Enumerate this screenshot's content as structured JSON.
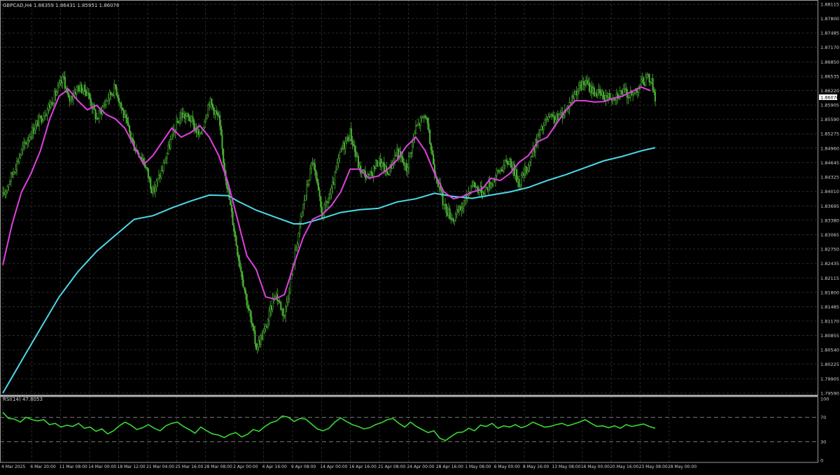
{
  "header": {
    "symbol": "GBPCAD,H4",
    "ohlc": "1.86359 1.86431 1.85951 1.86076"
  },
  "rsi_header": "RSI(14) 47.8053",
  "colors": {
    "background": "#000000",
    "grid": "#3a3a3a",
    "candles": "#4caf37",
    "ma_fast": "#e040e0",
    "ma_slow": "#4dd9e8",
    "rsi": "#39d833",
    "axis_text": "#cfcfcf",
    "price_tag_bg": "#ffffff"
  },
  "chart_data": [
    {
      "type": "candlestick",
      "title": "GBPCAD,H4",
      "price_axis_ticks": [
        "1.88115",
        "1.87800",
        "1.87485",
        "1.87170",
        "1.86850",
        "1.86535",
        "1.86220",
        "1.85905",
        "1.85590",
        "1.85275",
        "1.84960",
        "1.84645",
        "1.84325",
        "1.84010",
        "1.83695",
        "1.83380",
        "1.83065",
        "1.82750",
        "1.82435",
        "1.82115",
        "1.81800",
        "1.81485",
        "1.81170",
        "1.80855",
        "1.80540",
        "1.80225",
        "1.79905",
        "1.79590"
      ],
      "current_price_label": "1.86076",
      "ylim": [
        1.7959,
        1.88115
      ],
      "grid": true,
      "time_axis_labels": [
        "4 Mar 2025",
        "6 Mar 20:00",
        "11 Mar 08:00",
        "14 Mar 00:00",
        "18 Mar 12:00",
        "21 Mar 04:00",
        "25 Mar 16:00",
        "28 Mar 08:00",
        "2 Apr 00:00",
        "4 Apr 16:00",
        "9 Apr 08:00",
        "14 Apr 00:00",
        "16 Apr 16:00",
        "21 Apr 08:00",
        "24 Apr 00:00",
        "28 Apr 16:00",
        "1 May 08:00",
        "6 May 00:00",
        "8 May 16:00",
        "13 May 08:00",
        "16 May 00:00",
        "20 May 16:00",
        "23 May 08:00",
        "28 May 00:00"
      ],
      "price_path": [
        [
          0,
          1.839
        ],
        [
          2,
          1.844
        ],
        [
          4,
          1.849
        ],
        [
          6,
          1.853
        ],
        [
          8,
          1.856
        ],
        [
          10,
          1.859
        ],
        [
          12,
          1.863
        ],
        [
          13,
          1.865
        ],
        [
          14,
          1.86
        ],
        [
          16,
          1.863
        ],
        [
          18,
          1.862
        ],
        [
          20,
          1.856
        ],
        [
          22,
          1.86
        ],
        [
          24,
          1.863
        ],
        [
          26,
          1.856
        ],
        [
          28,
          1.85
        ],
        [
          30,
          1.847
        ],
        [
          32,
          1.84
        ],
        [
          34,
          1.845
        ],
        [
          36,
          1.852
        ],
        [
          38,
          1.857
        ],
        [
          40,
          1.856
        ],
        [
          42,
          1.852
        ],
        [
          44,
          1.86
        ],
        [
          46,
          1.856
        ],
        [
          47,
          1.847
        ],
        [
          48,
          1.84
        ],
        [
          50,
          1.827
        ],
        [
          52,
          1.816
        ],
        [
          54,
          1.806
        ],
        [
          56,
          1.81
        ],
        [
          58,
          1.818
        ],
        [
          60,
          1.813
        ],
        [
          62,
          1.825
        ],
        [
          64,
          1.837
        ],
        [
          66,
          1.847
        ],
        [
          68,
          1.835
        ],
        [
          70,
          1.84
        ],
        [
          72,
          1.849
        ],
        [
          74,
          1.853
        ],
        [
          76,
          1.845
        ],
        [
          78,
          1.843
        ],
        [
          80,
          1.847
        ],
        [
          82,
          1.844
        ],
        [
          84,
          1.849
        ],
        [
          86,
          1.845
        ],
        [
          88,
          1.854
        ],
        [
          90,
          1.857
        ],
        [
          92,
          1.845
        ],
        [
          94,
          1.837
        ],
        [
          96,
          1.834
        ],
        [
          98,
          1.837
        ],
        [
          100,
          1.842
        ],
        [
          102,
          1.84
        ],
        [
          104,
          1.842
        ],
        [
          106,
          1.845
        ],
        [
          108,
          1.847
        ],
        [
          110,
          1.842
        ],
        [
          112,
          1.846
        ],
        [
          114,
          1.852
        ],
        [
          116,
          1.856
        ],
        [
          118,
          1.856
        ],
        [
          120,
          1.858
        ],
        [
          122,
          1.862
        ],
        [
          124,
          1.864
        ],
        [
          126,
          1.862
        ],
        [
          128,
          1.861
        ],
        [
          130,
          1.861
        ],
        [
          132,
          1.862
        ],
        [
          134,
          1.861
        ],
        [
          136,
          1.864
        ],
        [
          138,
          1.865
        ],
        [
          139,
          1.8608
        ]
      ],
      "ma_fast": [
        [
          0,
          1.824
        ],
        [
          2,
          1.833
        ],
        [
          4,
          1.84
        ],
        [
          6,
          1.844
        ],
        [
          8,
          1.849
        ],
        [
          10,
          1.856
        ],
        [
          12,
          1.861
        ],
        [
          14,
          1.8625
        ],
        [
          16,
          1.86
        ],
        [
          18,
          1.858
        ],
        [
          20,
          1.859
        ],
        [
          22,
          1.857
        ],
        [
          24,
          1.856
        ],
        [
          26,
          1.854
        ],
        [
          28,
          1.85
        ],
        [
          30,
          1.846
        ],
        [
          32,
          1.848
        ],
        [
          34,
          1.851
        ],
        [
          36,
          1.854
        ],
        [
          38,
          1.852
        ],
        [
          40,
          1.853
        ],
        [
          42,
          1.8545
        ],
        [
          44,
          1.852
        ],
        [
          46,
          1.848
        ],
        [
          48,
          1.842
        ],
        [
          50,
          1.834
        ],
        [
          52,
          1.826
        ],
        [
          54,
          1.823
        ],
        [
          56,
          1.817
        ],
        [
          58,
          1.8165
        ],
        [
          60,
          1.8175
        ],
        [
          62,
          1.824
        ],
        [
          64,
          1.83
        ],
        [
          66,
          1.834
        ],
        [
          68,
          1.835
        ],
        [
          70,
          1.837
        ],
        [
          72,
          1.84
        ],
        [
          74,
          1.845
        ],
        [
          76,
          1.845
        ],
        [
          78,
          1.843
        ],
        [
          80,
          1.8435
        ],
        [
          82,
          1.845
        ],
        [
          84,
          1.847
        ],
        [
          86,
          1.85
        ],
        [
          88,
          1.852
        ],
        [
          90,
          1.849
        ],
        [
          92,
          1.844
        ],
        [
          94,
          1.84
        ],
        [
          96,
          1.8385
        ],
        [
          98,
          1.839
        ],
        [
          100,
          1.84
        ],
        [
          102,
          1.8405
        ],
        [
          104,
          1.843
        ],
        [
          106,
          1.8425
        ],
        [
          108,
          1.844
        ],
        [
          110,
          1.8465
        ],
        [
          112,
          1.848
        ],
        [
          114,
          1.851
        ],
        [
          116,
          1.852
        ],
        [
          118,
          1.855
        ],
        [
          120,
          1.858
        ],
        [
          122,
          1.86
        ],
        [
          124,
          1.86
        ],
        [
          126,
          1.8597
        ],
        [
          128,
          1.8598
        ],
        [
          130,
          1.8605
        ],
        [
          132,
          1.861
        ],
        [
          134,
          1.862
        ],
        [
          136,
          1.863
        ],
        [
          138,
          1.8622
        ]
      ],
      "ma_slow": [
        [
          0,
          1.7959
        ],
        [
          4,
          1.803
        ],
        [
          8,
          1.81
        ],
        [
          12,
          1.817
        ],
        [
          16,
          1.8225
        ],
        [
          20,
          1.827
        ],
        [
          24,
          1.8305
        ],
        [
          28,
          1.834
        ],
        [
          32,
          1.8348
        ],
        [
          36,
          1.8365
        ],
        [
          40,
          1.838
        ],
        [
          44,
          1.8393
        ],
        [
          48,
          1.8392
        ],
        [
          50,
          1.838
        ],
        [
          54,
          1.836
        ],
        [
          58,
          1.8345
        ],
        [
          62,
          1.833
        ],
        [
          64,
          1.833
        ],
        [
          68,
          1.8342
        ],
        [
          72,
          1.8355
        ],
        [
          76,
          1.8361
        ],
        [
          80,
          1.8364
        ],
        [
          84,
          1.8378
        ],
        [
          88,
          1.8385
        ],
        [
          92,
          1.8397
        ],
        [
          96,
          1.839
        ],
        [
          100,
          1.8386
        ],
        [
          104,
          1.8393
        ],
        [
          108,
          1.84
        ],
        [
          112,
          1.841
        ],
        [
          116,
          1.8425
        ],
        [
          120,
          1.8438
        ],
        [
          124,
          1.8453
        ],
        [
          128,
          1.8468
        ],
        [
          132,
          1.8478
        ],
        [
          136,
          1.849
        ],
        [
          139,
          1.8497
        ]
      ]
    },
    {
      "type": "line",
      "title": "RSI(14) 47.8053",
      "ylim": [
        0,
        100
      ],
      "y_ticks": [
        "100",
        "70",
        "30",
        "0"
      ],
      "levels": [
        70,
        30
      ],
      "values": [
        78,
        68,
        67,
        62,
        70,
        66,
        64,
        66,
        58,
        60,
        54,
        57,
        55,
        60,
        52,
        54,
        47,
        51,
        43,
        48,
        56,
        62,
        57,
        50,
        53,
        58,
        52,
        48,
        56,
        60,
        62,
        55,
        50,
        44,
        54,
        48,
        43,
        41,
        37,
        42,
        45,
        38,
        42,
        50,
        47,
        55,
        61,
        64,
        72,
        70,
        63,
        68,
        67,
        59,
        51,
        48,
        52,
        62,
        69,
        63,
        58,
        55,
        51,
        53,
        58,
        61,
        66,
        68,
        60,
        54,
        62,
        55,
        50,
        45,
        48,
        36,
        32,
        39,
        45,
        46,
        52,
        48,
        57,
        55,
        60,
        52,
        56,
        54,
        58,
        53,
        56,
        62,
        58,
        54,
        55,
        58,
        60,
        56,
        59,
        62,
        66,
        60,
        55,
        56,
        53,
        56,
        52,
        58,
        55,
        57,
        59,
        55,
        52
      ]
    }
  ]
}
